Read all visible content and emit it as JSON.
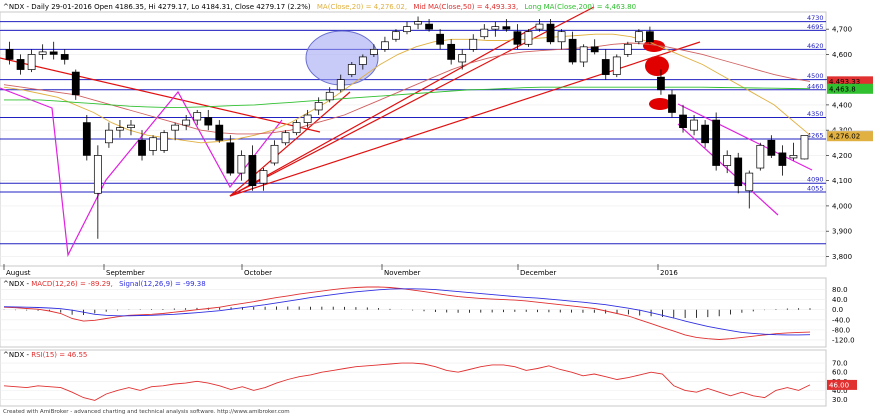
{
  "header": {
    "symbol_line": "^NDX - Daily 29-01-2016 Open 4186.35, Hi 4279.17, Lo 4184.31, Close 4279.17 (2.2%)",
    "ma20": "MA(Close,20) = 4,276.02,",
    "ma50": "Mid MA(Close,50) = 4,493.33,",
    "ma200": "Long MA(Close,200) = 4,463.80"
  },
  "macd_header": {
    "prefix": "^NDX - ",
    "macd": "MACD(12,26) = -89.29,",
    "signal": "Signal(12,26,9) = -99.38"
  },
  "rsi_header": {
    "prefix": "^NDX - ",
    "rsi": "RSI(15) = 46.55"
  },
  "footer": {
    "credit": "Created with AmiBroker - advanced charting and technical analysis software. http://www.amibroker.com"
  },
  "colors": {
    "ma20": "#e0b040",
    "ma50": "#d06060",
    "ma200": "#30c030",
    "horizontal": "#2020c0",
    "trendline": "#e01010",
    "channel": "#e020e0",
    "macd": "#e03030",
    "signal": "#3030e0",
    "rsi": "#e03030"
  },
  "chart_data": [
    {
      "type": "candlestick",
      "x_labels": [
        "August",
        "September",
        "October",
        "November",
        "December",
        "2016"
      ],
      "y_ticks": [
        3800,
        3900,
        4000,
        4100,
        4200,
        4300,
        4400,
        4500,
        4600,
        4700
      ],
      "y_tick_labels": [
        "3,800",
        "3,900",
        "4,000",
        "4,100",
        "4,200",
        "4,300",
        "4,400",
        "4,500",
        "4,600",
        "4,700"
      ],
      "ylim": [
        3770,
        4760
      ],
      "horizontal_levels": [
        {
          "value": 4730,
          "label": "4730"
        },
        {
          "value": 4695,
          "label": "4695"
        },
        {
          "value": 4620,
          "label": "4620"
        },
        {
          "value": 4500,
          "label": "4500"
        },
        {
          "value": 4460,
          "label": "4460"
        },
        {
          "value": 4350,
          "label": "4350"
        },
        {
          "value": 4265,
          "label": "4265"
        },
        {
          "value": 4090,
          "label": "4090"
        },
        {
          "value": 4055,
          "label": "4055"
        },
        {
          "value": 3850,
          "label": ""
        }
      ],
      "value_tags": [
        {
          "value": 4493.33,
          "label": "4,493.33",
          "color": "#e03030"
        },
        {
          "value": 4463.8,
          "label": "4,463.8",
          "color": "#30c030"
        },
        {
          "value": 4279.17,
          "label": "4,279.17",
          "color": "#d0d0d0"
        },
        {
          "value": 4276.02,
          "label": "4,276.02",
          "color": "#e0b040"
        }
      ],
      "series": [
        {
          "name": "MA(Close,20)",
          "values": [
            4470,
            4460,
            4445,
            4430,
            4400,
            4370,
            4330,
            4300,
            4280,
            4270,
            4260,
            4250,
            4255,
            4265,
            4280,
            4300,
            4330,
            4370,
            4410,
            4460,
            4510,
            4560,
            4600,
            4630,
            4650,
            4660,
            4660,
            4655,
            4655,
            4660,
            4665,
            4670,
            4675,
            4680,
            4680,
            4670,
            4650,
            4620,
            4590,
            4560,
            4520,
            4480,
            4440,
            4400,
            4340,
            4280
          ]
        },
        {
          "name": "Mid MA(Close,50)",
          "values": [
            4480,
            4470,
            4460,
            4450,
            4440,
            4420,
            4400,
            4380,
            4360,
            4340,
            4320,
            4300,
            4290,
            4285,
            4285,
            4290,
            4300,
            4320,
            4340,
            4360,
            4390,
            4420,
            4450,
            4480,
            4510,
            4540,
            4565,
            4585,
            4600,
            4610,
            4615,
            4620,
            4625,
            4630,
            4640,
            4645,
            4640,
            4630,
            4615,
            4600,
            4580,
            4560,
            4540,
            4520,
            4505,
            4493
          ]
        },
        {
          "name": "Long MA(Close,200)",
          "values": [
            4420,
            4420,
            4420,
            4415,
            4410,
            4405,
            4400,
            4395,
            4392,
            4390,
            4390,
            4392,
            4395,
            4398,
            4400,
            4405,
            4410,
            4415,
            4420,
            4425,
            4430,
            4435,
            4440,
            4445,
            4450,
            4455,
            4460,
            4462,
            4465,
            4468,
            4470,
            4470,
            4470,
            4470,
            4470,
            4470,
            4470,
            4470,
            4470,
            4470,
            4469,
            4468,
            4467,
            4466,
            4465,
            4464
          ]
        }
      ],
      "candles": [
        {
          "o": 4620,
          "h": 4650,
          "l": 4560,
          "c": 4580
        },
        {
          "o": 4580,
          "h": 4600,
          "l": 4520,
          "c": 4540
        },
        {
          "o": 4540,
          "h": 4620,
          "l": 4530,
          "c": 4600
        },
        {
          "o": 4600,
          "h": 4640,
          "l": 4580,
          "c": 4610
        },
        {
          "o": 4610,
          "h": 4650,
          "l": 4580,
          "c": 4600
        },
        {
          "o": 4600,
          "h": 4620,
          "l": 4560,
          "c": 4580
        },
        {
          "o": 4530,
          "h": 4540,
          "l": 4420,
          "c": 4440
        },
        {
          "o": 4330,
          "h": 4360,
          "l": 4180,
          "c": 4200
        },
        {
          "o": 4050,
          "h": 4240,
          "l": 3870,
          "c": 4200
        },
        {
          "o": 4250,
          "h": 4330,
          "l": 4230,
          "c": 4300
        },
        {
          "o": 4300,
          "h": 4340,
          "l": 4270,
          "c": 4310
        },
        {
          "o": 4310,
          "h": 4340,
          "l": 4280,
          "c": 4320
        },
        {
          "o": 4260,
          "h": 4300,
          "l": 4180,
          "c": 4200
        },
        {
          "o": 4220,
          "h": 4280,
          "l": 4200,
          "c": 4270
        },
        {
          "o": 4220,
          "h": 4300,
          "l": 4210,
          "c": 4290
        },
        {
          "o": 4300,
          "h": 4330,
          "l": 4260,
          "c": 4320
        },
        {
          "o": 4320,
          "h": 4360,
          "l": 4300,
          "c": 4340
        },
        {
          "o": 4340,
          "h": 4380,
          "l": 4320,
          "c": 4370
        },
        {
          "o": 4350,
          "h": 4380,
          "l": 4300,
          "c": 4320
        },
        {
          "o": 4320,
          "h": 4340,
          "l": 4250,
          "c": 4260
        },
        {
          "o": 4250,
          "h": 4280,
          "l": 4120,
          "c": 4130
        },
        {
          "o": 4130,
          "h": 4220,
          "l": 4100,
          "c": 4200
        },
        {
          "o": 4200,
          "h": 4240,
          "l": 4060,
          "c": 4080
        },
        {
          "o": 4090,
          "h": 4150,
          "l": 4060,
          "c": 4140
        },
        {
          "o": 4170,
          "h": 4260,
          "l": 4160,
          "c": 4240
        },
        {
          "o": 4250,
          "h": 4300,
          "l": 4240,
          "c": 4290
        },
        {
          "o": 4290,
          "h": 4340,
          "l": 4280,
          "c": 4330
        },
        {
          "o": 4330,
          "h": 4380,
          "l": 4310,
          "c": 4360
        },
        {
          "o": 4380,
          "h": 4430,
          "l": 4360,
          "c": 4410
        },
        {
          "o": 4420,
          "h": 4470,
          "l": 4410,
          "c": 4450
        },
        {
          "o": 4460,
          "h": 4520,
          "l": 4450,
          "c": 4500
        },
        {
          "o": 4520,
          "h": 4570,
          "l": 4510,
          "c": 4560
        },
        {
          "o": 4560,
          "h": 4600,
          "l": 4540,
          "c": 4590
        },
        {
          "o": 4600,
          "h": 4640,
          "l": 4590,
          "c": 4620
        },
        {
          "o": 4620,
          "h": 4670,
          "l": 4610,
          "c": 4650
        },
        {
          "o": 4660,
          "h": 4700,
          "l": 4650,
          "c": 4690
        },
        {
          "o": 4690,
          "h": 4730,
          "l": 4680,
          "c": 4710
        },
        {
          "o": 4720,
          "h": 4750,
          "l": 4700,
          "c": 4730
        },
        {
          "o": 4720,
          "h": 4740,
          "l": 4690,
          "c": 4700
        },
        {
          "o": 4680,
          "h": 4700,
          "l": 4620,
          "c": 4640
        },
        {
          "o": 4640,
          "h": 4660,
          "l": 4560,
          "c": 4580
        },
        {
          "o": 4570,
          "h": 4620,
          "l": 4540,
          "c": 4600
        },
        {
          "o": 4620,
          "h": 4680,
          "l": 4610,
          "c": 4660
        },
        {
          "o": 4670,
          "h": 4720,
          "l": 4660,
          "c": 4700
        },
        {
          "o": 4700,
          "h": 4730,
          "l": 4670,
          "c": 4710
        },
        {
          "o": 4710,
          "h": 4740,
          "l": 4690,
          "c": 4700
        },
        {
          "o": 4690,
          "h": 4720,
          "l": 4620,
          "c": 4640
        },
        {
          "o": 4640,
          "h": 4700,
          "l": 4630,
          "c": 4690
        },
        {
          "o": 4700,
          "h": 4740,
          "l": 4690,
          "c": 4720
        },
        {
          "o": 4720,
          "h": 4740,
          "l": 4640,
          "c": 4650
        },
        {
          "o": 4650,
          "h": 4700,
          "l": 4620,
          "c": 4690
        },
        {
          "o": 4660,
          "h": 4690,
          "l": 4560,
          "c": 4570
        },
        {
          "o": 4570,
          "h": 4640,
          "l": 4550,
          "c": 4630
        },
        {
          "o": 4630,
          "h": 4660,
          "l": 4600,
          "c": 4610
        },
        {
          "o": 4580,
          "h": 4620,
          "l": 4500,
          "c": 4520
        },
        {
          "o": 4520,
          "h": 4600,
          "l": 4510,
          "c": 4590
        },
        {
          "o": 4600,
          "h": 4650,
          "l": 4590,
          "c": 4640
        },
        {
          "o": 4650,
          "h": 4700,
          "l": 4640,
          "c": 4690
        },
        {
          "o": 4690,
          "h": 4710,
          "l": 4640,
          "c": 4650
        },
        {
          "o": 4510,
          "h": 4540,
          "l": 4440,
          "c": 4460
        },
        {
          "o": 4440,
          "h": 4460,
          "l": 4350,
          "c": 4370
        },
        {
          "o": 4360,
          "h": 4400,
          "l": 4290,
          "c": 4310
        },
        {
          "o": 4300,
          "h": 4360,
          "l": 4280,
          "c": 4340
        },
        {
          "o": 4320,
          "h": 4340,
          "l": 4230,
          "c": 4250
        },
        {
          "o": 4340,
          "h": 4370,
          "l": 4140,
          "c": 4160
        },
        {
          "o": 4160,
          "h": 4220,
          "l": 4130,
          "c": 4200
        },
        {
          "o": 4190,
          "h": 4210,
          "l": 4050,
          "c": 4080
        },
        {
          "o": 4060,
          "h": 4140,
          "l": 3990,
          "c": 4130
        },
        {
          "o": 4150,
          "h": 4250,
          "l": 4140,
          "c": 4240
        },
        {
          "o": 4260,
          "h": 4280,
          "l": 4190,
          "c": 4200
        },
        {
          "o": 4210,
          "h": 4240,
          "l": 4120,
          "c": 4160
        },
        {
          "o": 4190,
          "h": 4250,
          "l": 4180,
          "c": 4200
        },
        {
          "o": 4186,
          "h": 4279,
          "l": 4184,
          "c": 4279
        }
      ]
    },
    {
      "type": "line",
      "title": "MACD",
      "y_ticks": [
        -120,
        -80,
        -40,
        0,
        40,
        80
      ],
      "y_tick_labels": [
        "-120.0",
        "-80.0",
        "-40.0",
        "0.0",
        "40.0",
        "80.0"
      ],
      "ylim": [
        -140,
        110
      ],
      "series": [
        {
          "name": "MACD(12,26)",
          "values": [
            10,
            8,
            5,
            2,
            -5,
            -15,
            -35,
            -45,
            -42,
            -35,
            -28,
            -22,
            -20,
            -18,
            -15,
            -10,
            -5,
            0,
            5,
            10,
            18,
            25,
            32,
            40,
            48,
            55,
            62,
            68,
            74,
            80,
            85,
            88,
            90,
            90,
            88,
            84,
            78,
            72,
            65,
            58,
            52,
            48,
            45,
            42,
            40,
            38,
            35,
            30,
            25,
            20,
            15,
            10,
            5,
            -5,
            -15,
            -25,
            -40,
            -55,
            -70,
            -85,
            -100,
            -110,
            -115,
            -118,
            -115,
            -110,
            -105,
            -100,
            -95,
            -92,
            -90,
            -89
          ]
        },
        {
          "name": "Signal(12,26,9)",
          "values": [
            12,
            11,
            10,
            9,
            7,
            4,
            -2,
            -10,
            -18,
            -22,
            -24,
            -24,
            -23,
            -22,
            -20,
            -18,
            -15,
            -12,
            -8,
            -4,
            2,
            8,
            14,
            20,
            27,
            34,
            41,
            48,
            54,
            60,
            66,
            71,
            75,
            79,
            82,
            83,
            83,
            82,
            80,
            76,
            72,
            68,
            64,
            60,
            56,
            52,
            49,
            46,
            42,
            38,
            34,
            30,
            25,
            20,
            13,
            6,
            -2,
            -12,
            -22,
            -33,
            -45,
            -56,
            -66,
            -75,
            -83,
            -90,
            -94,
            -97,
            -99,
            -100,
            -100,
            -99
          ]
        }
      ]
    },
    {
      "type": "line",
      "title": "RSI",
      "y_ticks": [
        30,
        40,
        50,
        60,
        70
      ],
      "y_tick_labels": [
        "30.0",
        "40.0",
        "50.0",
        "60.0",
        "70.0"
      ],
      "ylim": [
        25,
        80
      ],
      "series": [
        {
          "name": "RSI(15)",
          "values": [
            45,
            44,
            43,
            45,
            44,
            43,
            38,
            32,
            29,
            36,
            40,
            43,
            40,
            44,
            45,
            47,
            48,
            50,
            48,
            45,
            41,
            44,
            40,
            43,
            48,
            52,
            55,
            57,
            60,
            62,
            64,
            66,
            67,
            68,
            69,
            70,
            70,
            69,
            66,
            62,
            60,
            63,
            66,
            68,
            68,
            66,
            62,
            64,
            67,
            63,
            60,
            56,
            58,
            55,
            52,
            54,
            57,
            60,
            58,
            45,
            40,
            38,
            42,
            38,
            34,
            38,
            34,
            32,
            40,
            43,
            40,
            46
          ]
        }
      ]
    }
  ]
}
